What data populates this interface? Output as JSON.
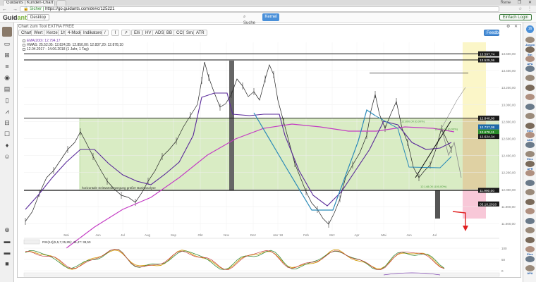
{
  "browser": {
    "tab_title": "Guidants | Kunden-Chart",
    "new_tab": "",
    "user_name": "Rene",
    "window_controls": "– ❐ ✕",
    "nav_buttons": "← → ⟳",
    "secure_label": "Sicher",
    "url": "https://go.guidants.com/de#c/125221",
    "extension_icons": "☆ ⋮"
  },
  "app": {
    "logo_prefix": "Guid",
    "logo_suffix": "ants",
    "desktop_button": "Desktop",
    "search_button": "Suche",
    "chart_button": "Kernel",
    "login_button": "Einfach Login"
  },
  "panel": {
    "title": "Chart zum Tool EXTRA FREE",
    "window_controls": "⚙ ✕"
  },
  "toolbar": [
    {
      "id": "chart",
      "label": "Chart"
    },
    {
      "id": "wert",
      "label": "Wert"
    },
    {
      "id": "kerzen",
      "label": "Kerzen"
    },
    {
      "id": "tf",
      "label": "1h"
    },
    {
      "id": "modelle",
      "label": "4-Modelle"
    },
    {
      "id": "indikatoren",
      "label": "Indikatoren"
    },
    {
      "id": "t1",
      "label": "/"
    },
    {
      "id": "t2",
      "label": "⌇"
    },
    {
      "id": "t3",
      "label": "↗"
    },
    {
      "id": "t4",
      "label": "Elli"
    },
    {
      "id": "t5",
      "label": "HV"
    },
    {
      "id": "t6",
      "label": "ADS"
    },
    {
      "id": "t7",
      "label": "BB"
    },
    {
      "id": "t8",
      "label": "CCI"
    },
    {
      "id": "t9",
      "label": "Sma"
    },
    {
      "id": "t10",
      "label": "ATR"
    }
  ],
  "feedback_button": "Feedback",
  "legend": {
    "line1": "EMA(200): 12.794,17",
    "line2": "HMAS: 25.52.05: 12.824,35: 12.850,00: 12.837,20: 12.878,10",
    "line3": "12.04.2017 - 14.06.2018 (1 Jahr, 1 Tag)"
  },
  "chart_data": {
    "type": "line",
    "x_tick_labels": [
      "Mai",
      "Jun",
      "Jul",
      "Aug",
      "Sep",
      "Okt",
      "Nov",
      "Dez",
      "Jan '18",
      "Feb",
      "Mrz",
      "Apr",
      "Mai",
      "Jun",
      "Jul"
    ],
    "y_ticks": [
      13600,
      13400,
      13200,
      13000,
      12800,
      12600,
      12400,
      12200,
      12000,
      11800,
      11600
    ],
    "price_labels": [
      {
        "value": 13597,
        "label": "13.597,74",
        "color": "#1a1a1a"
      },
      {
        "value": 13525,
        "label": "13.525,06",
        "color": "#1a1a1a"
      },
      {
        "value": 12840,
        "label": "12.840,00",
        "color": "#1a1a1a"
      },
      {
        "value": 12737,
        "label": "12.737,08",
        "color": "#1e6aa8"
      },
      {
        "value": 12678,
        "label": "12.678,11",
        "color": "#2a8a2a"
      },
      {
        "value": 12624,
        "label": "12.624,34",
        "color": "#1a1a1a"
      },
      {
        "value": 11990,
        "label": "11.990,00",
        "color": "#1a1a1a"
      },
      {
        "value": 11830,
        "label": "03.10.2018",
        "color": "#1a1a1a"
      }
    ],
    "annotations": {
      "box_label": "horizontale Seitwärtsbewegung größer Basisanalyse",
      "fib_top": "12.800,00 (0,00%)",
      "fib_mid": "12.700,00 (0,00%)",
      "fib_low": "12.148,00 (100,00%)",
      "oscillator_label": "RSI(14)(5,5,7,25,85): 46,47: 38,50"
    },
    "oscillator_ticks": [
      100,
      50,
      0
    ]
  },
  "sidebar_left": {
    "icons": [
      "avatar",
      "monitor-icon",
      "chart-icon",
      "list-icon",
      "eye-icon",
      "card-icon",
      "book-icon",
      "trend-icon",
      "grid-icon",
      "phone-icon",
      "bell-icon",
      "user-icon"
    ],
    "bottom_icons": [
      "plus-icon",
      "folder-icon",
      "folder-icon",
      "stop-icon"
    ]
  },
  "sidebar_right": {
    "badge": "16",
    "items": [
      "Jürgen",
      "Ein",
      "APA",
      "",
      "",
      "",
      "",
      "",
      "",
      "Eins",
      "ADR",
      "",
      "Eins",
      "AFR",
      "",
      "",
      "",
      "",
      "",
      "",
      "",
      "",
      "Eins",
      "",
      "APA"
    ]
  }
}
